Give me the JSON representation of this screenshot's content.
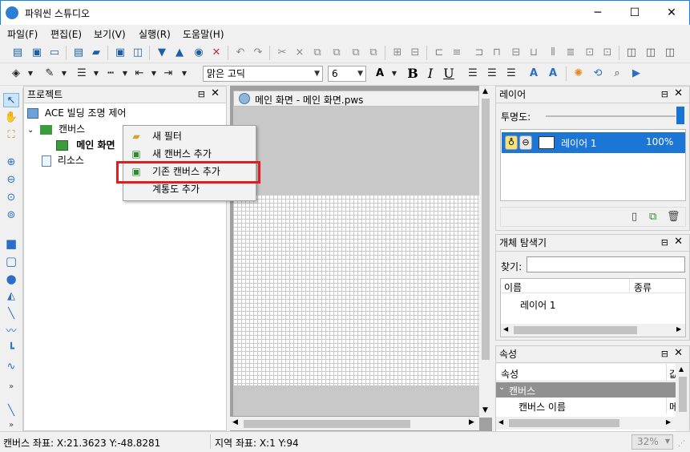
{
  "window": {
    "title": "파워씬 스튜디오",
    "minimize": "─",
    "maximize": "☐",
    "close": "✕"
  },
  "menu": [
    "파일(F)",
    "편집(E)",
    "보기(V)",
    "실행(R)",
    "도움말(H)"
  ],
  "toolbar2": {
    "font_name": "맑은 고딕",
    "font_size": "6",
    "bold": "B",
    "italic": "I",
    "underline": "U"
  },
  "project_panel": {
    "title": "프로젝트",
    "tree": {
      "root": "ACE 빌딩 조명 제어",
      "canvas_folder": "캔버스",
      "main_canvas": "메인 화면",
      "resources": "리소스"
    }
  },
  "context_menu": {
    "items": [
      "새 필터",
      "새 캔버스 추가",
      "기존 캔버스 추가",
      "계통도 추가"
    ],
    "highlighted_index": 2
  },
  "document": {
    "tab_label": "메인 화면 - 메인 화면.pws"
  },
  "layer_panel": {
    "title": "레이어",
    "opacity_label": "투명도:",
    "layer_name": "레이어 1",
    "layer_opacity": "100%"
  },
  "explorer_panel": {
    "title": "개체 탐색기",
    "search_label": "찾기:",
    "col_name": "이름",
    "col_type": "종류",
    "item": "레이어 1"
  },
  "props_panel": {
    "title": "속성",
    "col_prop": "속성",
    "col_value_partial": "값",
    "category": "캔버스",
    "row_name": "캔버스 이름",
    "row_value_partial": "메"
  },
  "status": {
    "canvas_coords": "캔버스 좌표: X:21.3623 Y:-48.8281",
    "region_coords": "지역 좌표: X:1 Y:94",
    "zoom": "32%"
  }
}
